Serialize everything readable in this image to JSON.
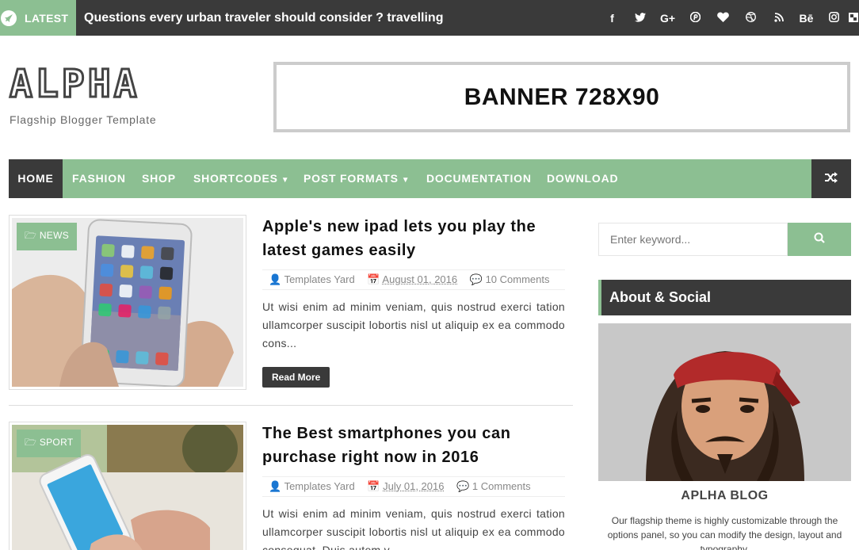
{
  "topbar": {
    "latest_label": "LATEST",
    "ticker": "Questions every urban traveler should consider ? travelling",
    "social_icons": [
      "facebook-icon",
      "twitter-icon",
      "google-plus-icon",
      "pinterest-icon",
      "heart-icon",
      "dribbble-icon",
      "rss-icon",
      "behance-icon",
      "instagram-icon",
      "flickr-icon"
    ]
  },
  "header": {
    "logo": "ALPHA",
    "tagline": "Flagship Blogger Template",
    "banner": "BANNER 728X90"
  },
  "nav": {
    "home": "HOME",
    "fashion": "FASHION",
    "shop": "SHOP",
    "shortcodes": "SHORTCODES",
    "post_formats": "POST FORMATS",
    "documentation": "DOCUMENTATION",
    "download": "DOWNLOAD"
  },
  "posts": [
    {
      "category": "NEWS",
      "title": "Apple's new ipad lets you play the latest games easily",
      "author": "Templates Yard",
      "date": "August 01, 2016",
      "comments": "10 Comments",
      "excerpt": "Ut wisi enim ad minim veniam, quis nostrud exerci tation ullamcorper suscipit lobortis nisl ut aliquip ex ea commodo cons...",
      "read_more": "Read More"
    },
    {
      "category": "SPORT",
      "title": "The Best smartphones you can purchase right now in 2016",
      "author": "Templates Yard",
      "date": "July 01, 2016",
      "comments": "1 Comments",
      "excerpt": "Ut wisi enim ad minim veniam, quis nostrud exerci tation ullamcorper suscipit lobortis nisl ut aliquip ex ea commodo consequat. Duis autem v..."
    }
  ],
  "sidebar": {
    "search_placeholder": "Enter keyword...",
    "widget_title": "About & Social",
    "blog_name": "APLHA BLOG",
    "blog_desc": "Our flagship theme is highly customizable through the options panel, so you can modify the design, layout and typography."
  },
  "colors": {
    "accent": "#8cbf92",
    "dark": "#3a3a3a"
  }
}
